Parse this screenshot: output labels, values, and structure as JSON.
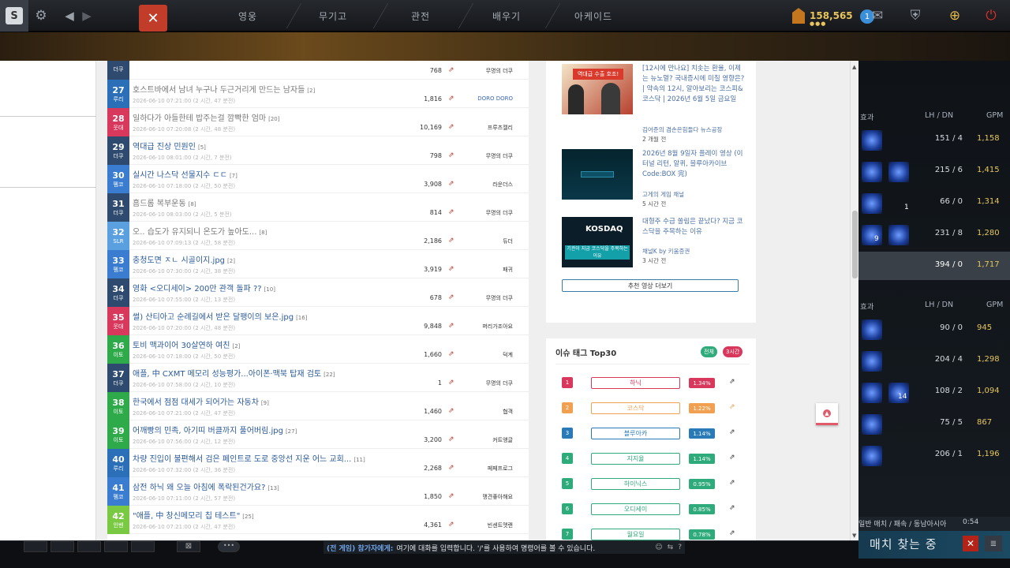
{
  "topbar": {
    "nav": [
      "영웅",
      "무기고",
      "관전",
      "배우기",
      "아케이드"
    ],
    "gold": "158,565",
    "gold_dots": "●●●",
    "notif_count": "1",
    "icons": [
      "dota-logo",
      "gear-icon",
      "back-arrow-icon",
      "mail-icon",
      "armory-icon",
      "plus-icon",
      "power-icon"
    ]
  },
  "board": {
    "top_partial": {
      "views": "768",
      "author": "무명의 더쿠"
    },
    "rows": [
      {
        "num": "27",
        "cat": "루리",
        "color": "#2a6fb7",
        "title": "호스트바에서 남녀 누구나 두근거리게 만드는 남자들",
        "comments": "[2]",
        "time": "2026-06-10 07:21:00 (2 시간, 47 분전)",
        "views": "1,816",
        "author": "DORO DORO",
        "author_color": "#3b67b3",
        "grey": true
      },
      {
        "num": "28",
        "cat": "웃대",
        "color": "#d9385d",
        "title": "일하다가 아들한테 밥주는걸 깜빡한 엄마",
        "comments": "[20]",
        "time": "2026-06-10 07:20:08 (2 시간, 48 분전)",
        "views": "10,169",
        "author": "프루츠젤리",
        "grey": true
      },
      {
        "num": "29",
        "cat": "더쿠",
        "color": "#2e4a6e",
        "title": "역대급 진상 민원인",
        "comments": "[5]",
        "time": "2026-06-10 08:01:00 (2 시간, 7 분전)",
        "views": "798",
        "author": "무명의 더쿠"
      },
      {
        "num": "30",
        "cat": "펨코",
        "color": "#3a7ccf",
        "title": "실시간 나스닥 선물지수 ㄷㄷ",
        "comments": "[7]",
        "time": "2026-06-10 07:18:00 (2 시간, 50 분전)",
        "views": "3,908",
        "author": "라운더스"
      },
      {
        "num": "31",
        "cat": "더쿠",
        "color": "#2e4a6e",
        "title": "흠드롬 복부운동",
        "comments": "[8]",
        "time": "2026-06-10 08:03:00 (2 시간, 5 분전)",
        "views": "814",
        "author": "무명의 더쿠",
        "grey": true
      },
      {
        "num": "32",
        "cat": "SLR",
        "color": "#5aa0e0",
        "title": "오.. 습도가 유지되니 온도가 높아도...",
        "comments": "[8]",
        "time": "2026-06-10 07:09:13 (2 시간, 58 분전)",
        "views": "2,186",
        "author": "듀더",
        "grey": true
      },
      {
        "num": "33",
        "cat": "펨코",
        "color": "#3a7ccf",
        "title": "충청도면 ㅈㄴ 시골이지.jpg",
        "comments": "[2]",
        "time": "2026-06-10 07:30:00 (2 시간, 38 분전)",
        "views": "3,919",
        "author": "패귀"
      },
      {
        "num": "34",
        "cat": "더쿠",
        "color": "#2e4a6e",
        "title": "영화 <오디세이> 200만 관객 돌파 ??",
        "comments": "[10]",
        "time": "2026-06-10 07:55:00 (2 시간, 13 분전)",
        "views": "678",
        "author": "무명의 더쿠"
      },
      {
        "num": "35",
        "cat": "웃대",
        "color": "#d9385d",
        "title": "썰) 산티아고 순례길에서 받은 달팽이의 보은.jpg",
        "comments": "[16]",
        "time": "2026-06-10 07:20:00 (2 시간, 48 분전)",
        "views": "9,848",
        "author": "퍼리가조아요"
      },
      {
        "num": "36",
        "cat": "이토",
        "color": "#2faa4a",
        "title": "토비 맥과이어 30살연하 여친",
        "comments": "[2]",
        "time": "2026-06-10 07:18:00 (2 시간, 50 분전)",
        "views": "1,660",
        "author": "덕계"
      },
      {
        "num": "37",
        "cat": "더쿠",
        "color": "#2e4a6e",
        "title": "애플, 中 CXMT 메모리 성능평가...아이폰·맥북 탑재 검토",
        "comments": "[22]",
        "time": "2026-06-10 07:58:00 (2 시간, 10 분전)",
        "views": "1",
        "author": "무명의 더쿠"
      },
      {
        "num": "38",
        "cat": "이토",
        "color": "#2faa4a",
        "title": "한국에서 점점 대세가 되어가는 자동차",
        "comments": "[9]",
        "time": "2026-06-10 07:21:00 (2 시간, 47 분전)",
        "views": "1,460",
        "author": "협객"
      },
      {
        "num": "39",
        "cat": "이토",
        "color": "#2faa4a",
        "title": "어깨빵의 민족, 아기띠 버클까지 풀어버림.jpg",
        "comments": "[27]",
        "time": "2026-06-10 07:56:00 (2 시간, 12 분전)",
        "views": "3,200",
        "author": "커트앵글"
      },
      {
        "num": "40",
        "cat": "루리",
        "color": "#2a6fb7",
        "title": "차량 진입이 불편해서 검은 페인트로 도로 중앙선 지운 어느 교회...",
        "comments": "[11]",
        "time": "2026-06-10 07:32:00 (2 시간, 36 분전)",
        "views": "2,268",
        "author": "페페프로그"
      },
      {
        "num": "41",
        "cat": "펨코",
        "color": "#3a7ccf",
        "title": "삼전 하닉 왜 오늘 아침에 폭락된건가요?",
        "comments": "[13]",
        "time": "2026-06-10 07:11:00 (2 시간, 57 분전)",
        "views": "1,850",
        "author": "맹견좋아해요"
      },
      {
        "num": "42",
        "cat": "인벤",
        "color": "#7ac943",
        "title": "\"애플, 中 창신메모리 칩 테스트\"",
        "comments": "[25]",
        "time": "2026-06-10 07:21:00 (2 시간, 47 분전)",
        "views": "4,361",
        "author": "빈센트멧랜"
      }
    ]
  },
  "videos": [
    {
      "title": "[12시에 만나요] 치솟는 환율, 이제는 뉴노멀? 국내증시에 미칠 영향은? | 약속의 12시, 알아보리는 코스피&코스닥 | 2026년 6월 5일 금요일",
      "source": "김어준의 겸손은힘들다 뉴스공장",
      "time": "2 개월 전",
      "thumb_text": "역대급 수출 호조!"
    },
    {
      "title": "2026년 8월 9일자 플레이 영상 (이터널 리턴, 알퀴, 블루아카이브 Code:BOX 完)",
      "source": "고게의 게임 채널",
      "time": "5 시간 전",
      "thumb_text": ""
    },
    {
      "title": "대형주 수급 쏠림은 끝났다? 지금 코스닥을 주목하는 이유",
      "source": "채널K by 키움증권",
      "time": "3 시간 전",
      "thumb_text": "KOSDAQ",
      "thumb_text2": "기관이 지금 코스닥을 주목하는 이유"
    }
  ],
  "more_videos": "추천 영상 더보기",
  "tags": {
    "header": "이슈 태그 Top30",
    "btn_all": "전체",
    "btn_3h": "3시간",
    "items": [
      {
        "rank": "1",
        "name": "하닉",
        "pct": "1.34%",
        "color": "#d9385d"
      },
      {
        "rank": "2",
        "name": "코스닥",
        "pct": "1.22%",
        "color": "#f0a050"
      },
      {
        "rank": "3",
        "name": "블루아카",
        "pct": "1.14%",
        "color": "#2a7ab8"
      },
      {
        "rank": "4",
        "name": "지지율",
        "pct": "1.14%",
        "color": "#2faa7a"
      },
      {
        "rank": "5",
        "name": "하이닉스",
        "pct": "0.95%",
        "color": "#2faa7a"
      },
      {
        "rank": "6",
        "name": "오디세이",
        "pct": "0.85%",
        "color": "#2faa7a"
      },
      {
        "rank": "7",
        "name": "월요일",
        "pct": "0.78%",
        "color": "#2faa7a"
      }
    ]
  },
  "scoreboard": {
    "head": {
      "effect": "효과",
      "lhdn": "LH / DN",
      "gpm": "GPM"
    },
    "team1": [
      {
        "lh": "151 / 4",
        "gpm": "1,158"
      },
      {
        "lh": "215 / 6",
        "gpm": "1,415"
      },
      {
        "lh": "66 / 0",
        "gpm": "1,314"
      },
      {
        "lh": "231 / 8",
        "gpm": "1,280"
      }
    ],
    "team1_total": {
      "lh": "394 / 0",
      "gpm": "1,717"
    },
    "team2": [
      {
        "lh": "90 / 0",
        "gpm": "945"
      },
      {
        "lh": "204 / 4",
        "gpm": "1,298"
      },
      {
        "lh": "108 / 2",
        "gpm": "1,094"
      },
      {
        "lh": "75 / 5",
        "gpm": "867"
      },
      {
        "lh": "206 / 1",
        "gpm": "1,196"
      }
    ],
    "item_counts": [
      "1",
      "9",
      "14"
    ]
  },
  "status": {
    "mode": "일반 매치 / 패속 / 동남아시아",
    "time": "0:54"
  },
  "chat": {
    "label": "(전 게임) 참가자에게:",
    "placeholder": "여기에 대화를 입력합니다. '/'를 사용하여 명령어를 볼 수 있습니다."
  },
  "matchmaking": {
    "label": "매치 찾는 중",
    "cancel": "✕"
  }
}
